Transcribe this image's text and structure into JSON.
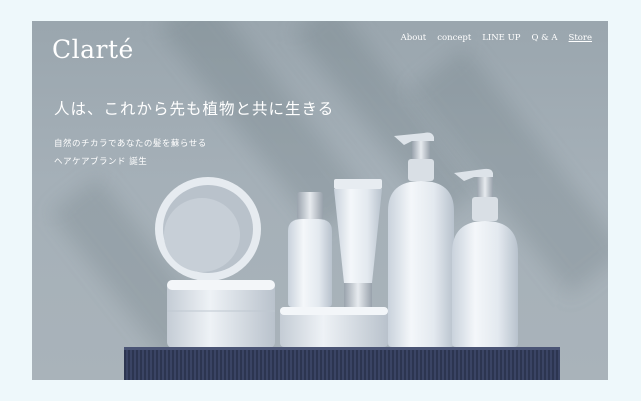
{
  "brand": {
    "logo": "Clarté"
  },
  "nav": {
    "items": [
      {
        "label": "About"
      },
      {
        "label": "concept"
      },
      {
        "label": "LINE UP"
      },
      {
        "label": "Q & A"
      },
      {
        "label": "Store"
      }
    ]
  },
  "hero": {
    "headline": "人は、これから先も植物と共に生きる",
    "sub1": "自然のチカラであなたの髪を蘇らせる",
    "sub2": "ヘアケアブランド 誕生"
  },
  "colors": {
    "page_bg": "#eef8fb",
    "hero_bg": "#a5b0b8",
    "pedestal": "#2c3550",
    "text": "#ffffff"
  }
}
